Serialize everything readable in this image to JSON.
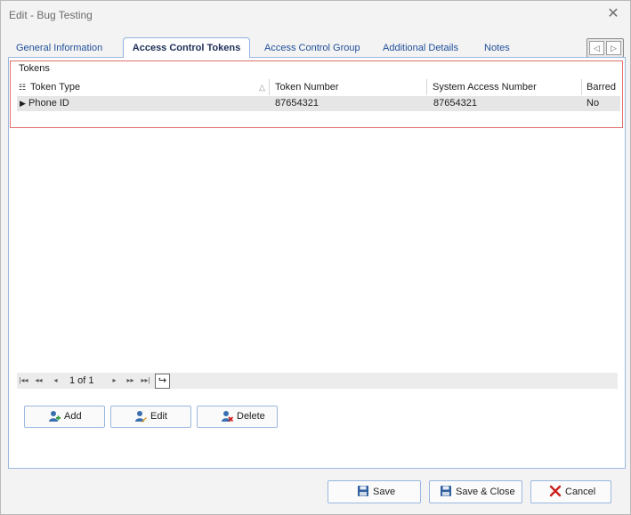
{
  "window": {
    "title": "Edit - Bug Testing",
    "close_glyph": "✕"
  },
  "tabs": [
    {
      "label": "General Information"
    },
    {
      "label": "Access Control Tokens"
    },
    {
      "label": "Access Control Group"
    },
    {
      "label": "Additional Details"
    },
    {
      "label": "Notes"
    }
  ],
  "tab_nav": {
    "prev_glyph": "◁",
    "next_glyph": "▷"
  },
  "tokens": {
    "title": "Tokens",
    "columns": [
      "Token Type",
      "Token Number",
      "System Access Number",
      "Barred"
    ],
    "sort_glyph": "△",
    "rows": [
      {
        "indicator": "▶",
        "token_type": "Phone ID",
        "token_number": "87654321",
        "system_access_number": "87654321",
        "barred": "No"
      }
    ]
  },
  "pager": {
    "first": "|◂◂",
    "prev_page": "◂◂",
    "prev": "◂",
    "info": "1 of 1",
    "next": "▸",
    "next_page": "▸▸",
    "last": "▸▸|",
    "refresh": "↪"
  },
  "actions": {
    "add_label": "Add",
    "edit_label": "Edit",
    "delete_label": "Delete"
  },
  "footer": {
    "save_label": "Save",
    "save_close_label": "Save & Close",
    "cancel_label": "Cancel"
  },
  "colors": {
    "accent": "#1f4f9a",
    "group_border": "#e07070",
    "cancel_red": "#cc1f1f",
    "user_icon": "#3a6fb0"
  }
}
